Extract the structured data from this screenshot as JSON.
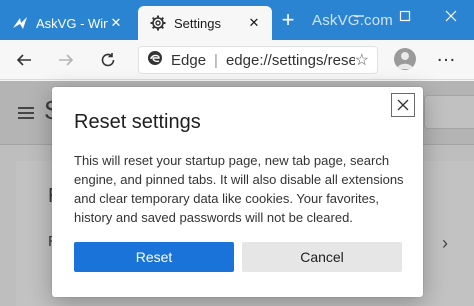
{
  "browser": {
    "tabs": [
      {
        "label": "AskVG - Wind",
        "icon": "askvg-logo-icon",
        "active": false
      },
      {
        "label": "Settings",
        "icon": "gear-icon",
        "active": true
      }
    ],
    "new_tab_label": "+",
    "watermark": "AskVG.com",
    "window_controls": [
      "minimize-icon",
      "maximize-icon",
      "close-icon"
    ],
    "accent_color": "#2b84d1"
  },
  "address_bar": {
    "site_label": "Edge",
    "url": "edge://settings/reset",
    "favorite_icon": "star-icon"
  },
  "page": {
    "title_fragment": "S",
    "fragment_1": "R",
    "fragment_2": "R"
  },
  "dialog": {
    "title": "Reset settings",
    "body": "This will reset your startup page, new tab page, search engine, and pinned tabs. It will also disable all extensions and clear temporary data like cookies. Your favorites, history and saved passwords will not be cleared.",
    "primary_button": "Reset",
    "secondary_button": "Cancel",
    "primary_color": "#1a73d8"
  }
}
